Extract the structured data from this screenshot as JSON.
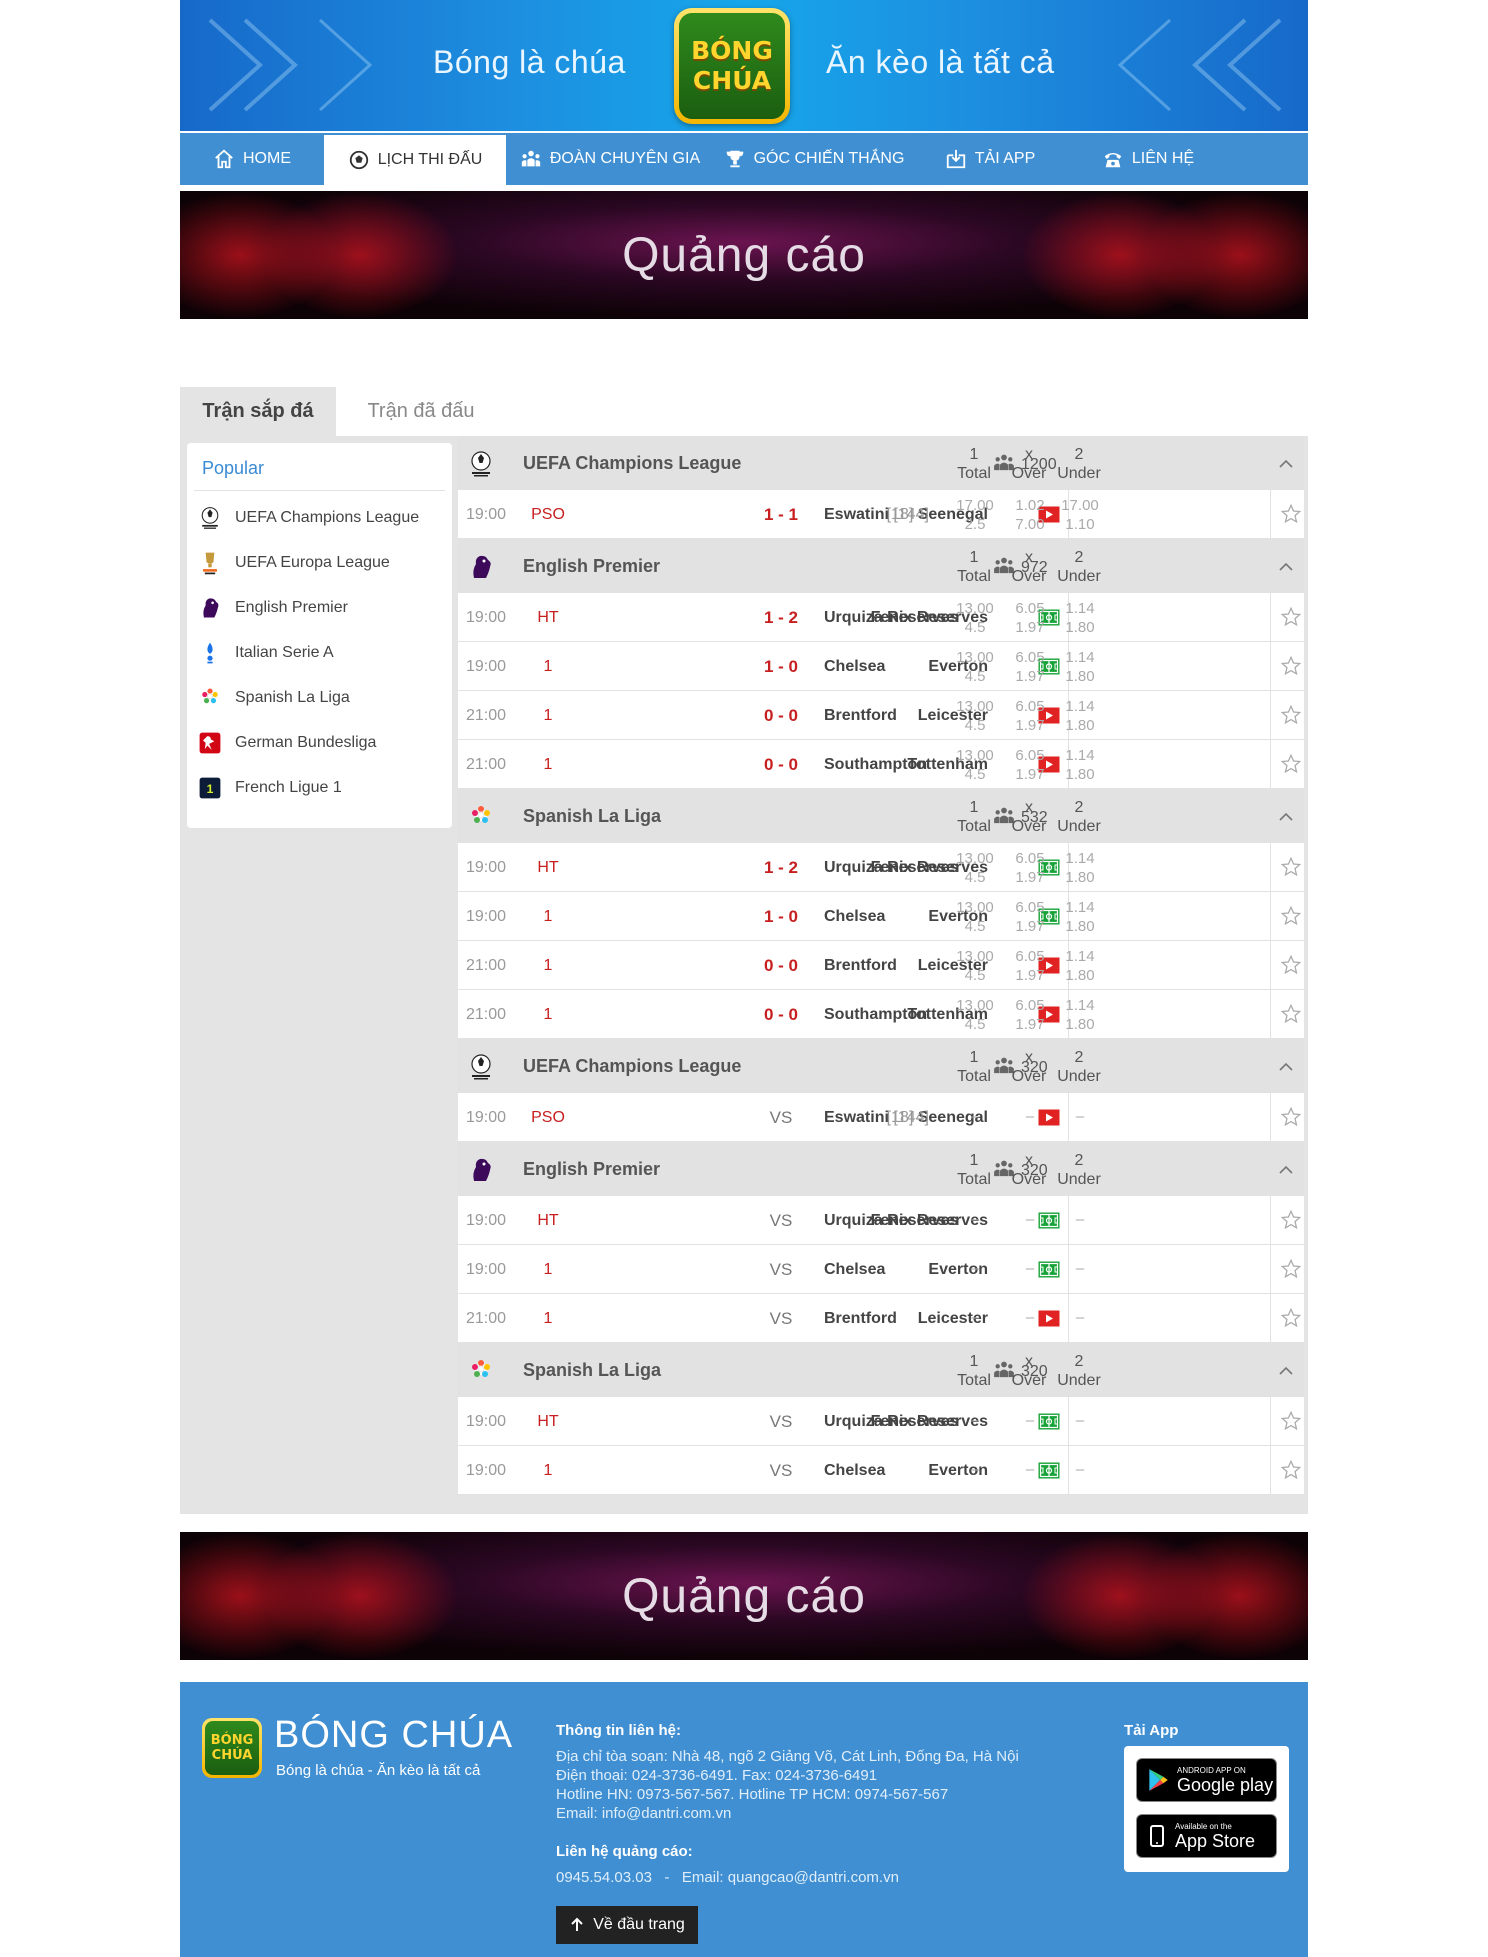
{
  "header": {
    "slogan_left": "Bóng là chúa",
    "slogan_right": "Ăn kèo là tất cả",
    "logo_line1": "BÓNG",
    "logo_line2": "CHÚA"
  },
  "nav": [
    {
      "label": "HOME",
      "icon": "home-icon",
      "active": false
    },
    {
      "label": "LỊCH THI ĐẤU",
      "icon": "soccer-ball-icon",
      "active": true
    },
    {
      "label": "ĐOÀN CHUYÊN GIA",
      "icon": "group-icon",
      "active": false
    },
    {
      "label": "GÓC CHIẾN THẮNG",
      "icon": "trophy-icon",
      "active": false
    },
    {
      "label": "TẢI APP",
      "icon": "download-icon",
      "active": false
    },
    {
      "label": "LIÊN HỆ",
      "icon": "phone-icon",
      "active": false
    }
  ],
  "ads": {
    "top": "Quảng cáo",
    "bottom": "Quảng cáo"
  },
  "tabs": {
    "upcoming": "Trận sắp đá",
    "played": "Trận đã đấu"
  },
  "sidebar": {
    "title": "Popular",
    "items": [
      {
        "label": "UEFA Champions League",
        "icon": "champions-league-icon"
      },
      {
        "label": "UEFA Europa League",
        "icon": "europa-league-icon"
      },
      {
        "label": "English Premier",
        "icon": "premier-league-icon"
      },
      {
        "label": "Italian Serie A",
        "icon": "serie-a-icon"
      },
      {
        "label": "Spanish La Liga",
        "icon": "la-liga-icon"
      },
      {
        "label": "German Bundesliga",
        "icon": "bundesliga-icon"
      },
      {
        "label": "French Ligue 1",
        "icon": "ligue-1-icon"
      }
    ]
  },
  "odds_columns": [
    {
      "top": "1",
      "bottom": "Total"
    },
    {
      "top": "x",
      "bottom": "Over"
    },
    {
      "top": "2",
      "bottom": "Under"
    }
  ],
  "leagues": [
    {
      "name": "UEFA Champions League",
      "icon": "champions-league-icon",
      "viewers": "1200",
      "matches": [
        {
          "time": "19:00",
          "status": "PSO",
          "home_rank": "[18]",
          "home": "Seenegal",
          "score": "1 - 1",
          "away": "Eswatini",
          "away_rank": "[144]",
          "media": "video",
          "odds": [
            [
              "17.00",
              "2.5"
            ],
            [
              "1.02",
              "7.00"
            ],
            [
              "17.00",
              "1.10"
            ]
          ]
        }
      ]
    },
    {
      "name": "English Premier",
      "icon": "premier-league-icon",
      "viewers": "972",
      "matches": [
        {
          "time": "19:00",
          "status": "HT",
          "home": "Fenix Reserves",
          "score": "1 - 2",
          "away": "Urquiza Reserves",
          "media": "pitch",
          "odds": [
            [
              "13.00",
              "4.5"
            ],
            [
              "6.05",
              "1.97"
            ],
            [
              "1.14",
              "1.80"
            ]
          ]
        },
        {
          "time": "19:00",
          "status": "1",
          "home": "Everton",
          "score": "1 - 0",
          "away": "Chelsea",
          "media": "pitch",
          "odds": [
            [
              "13.00",
              "4.5"
            ],
            [
              "6.05",
              "1.97"
            ],
            [
              "1.14",
              "1.80"
            ]
          ]
        },
        {
          "time": "21:00",
          "status": "1",
          "home": "Leicester",
          "score": "0 - 0",
          "away": "Brentford",
          "media": "video",
          "odds": [
            [
              "13.00",
              "4.5"
            ],
            [
              "6.05",
              "1.97"
            ],
            [
              "1.14",
              "1.80"
            ]
          ]
        },
        {
          "time": "21:00",
          "status": "1",
          "home": "Tottenham",
          "score": "0 - 0",
          "away": "Southampton",
          "media": "video",
          "odds": [
            [
              "13.00",
              "4.5"
            ],
            [
              "6.05",
              "1.97"
            ],
            [
              "1.14",
              "1.80"
            ]
          ]
        }
      ]
    },
    {
      "name": "Spanish La Liga",
      "icon": "la-liga-icon",
      "viewers": "532",
      "matches": [
        {
          "time": "19:00",
          "status": "HT",
          "home": "Fenix Reserves",
          "score": "1 - 2",
          "away": "Urquiza Reserves",
          "media": "pitch",
          "odds": [
            [
              "13.00",
              "4.5"
            ],
            [
              "6.05",
              "1.97"
            ],
            [
              "1.14",
              "1.80"
            ]
          ]
        },
        {
          "time": "19:00",
          "status": "1",
          "home": "Everton",
          "score": "1 - 0",
          "away": "Chelsea",
          "media": "pitch",
          "odds": [
            [
              "13.00",
              "4.5"
            ],
            [
              "6.05",
              "1.97"
            ],
            [
              "1.14",
              "1.80"
            ]
          ]
        },
        {
          "time": "21:00",
          "status": "1",
          "home": "Leicester",
          "score": "0 - 0",
          "away": "Brentford",
          "media": "video",
          "odds": [
            [
              "13.00",
              "4.5"
            ],
            [
              "6.05",
              "1.97"
            ],
            [
              "1.14",
              "1.80"
            ]
          ]
        },
        {
          "time": "21:00",
          "status": "1",
          "home": "Tottenham",
          "score": "0 - 0",
          "away": "Southampton",
          "media": "video",
          "odds": [
            [
              "13.00",
              "4.5"
            ],
            [
              "6.05",
              "1.97"
            ],
            [
              "1.14",
              "1.80"
            ]
          ]
        }
      ]
    },
    {
      "name": "UEFA Champions League",
      "icon": "champions-league-icon",
      "viewers": "320",
      "matches": [
        {
          "time": "19:00",
          "status": "PSO",
          "home_rank": "[18]",
          "home": "Seenegal",
          "score": "VS",
          "away": "Eswatini",
          "away_rank": "[144]",
          "media": "video",
          "odds": null
        }
      ]
    },
    {
      "name": "English Premier",
      "icon": "premier-league-icon",
      "viewers": "320",
      "matches": [
        {
          "time": "19:00",
          "status": "HT",
          "home": "Fenix Reserves",
          "score": "VS",
          "away": "Urquiza Reserves",
          "media": "pitch",
          "odds": null
        },
        {
          "time": "19:00",
          "status": "1",
          "home": "Everton",
          "score": "VS",
          "away": "Chelsea",
          "media": "pitch",
          "odds": null
        },
        {
          "time": "21:00",
          "status": "1",
          "home": "Leicester",
          "score": "VS",
          "away": "Brentford",
          "media": "video",
          "odds": null
        }
      ]
    },
    {
      "name": "Spanish La Liga",
      "icon": "la-liga-icon",
      "viewers": "320",
      "matches": [
        {
          "time": "19:00",
          "status": "HT",
          "home": "Fenix Reserves",
          "score": "VS",
          "away": "Urquiza Reserves",
          "media": "pitch",
          "odds": null
        },
        {
          "time": "19:00",
          "status": "1",
          "home": "Everton",
          "score": "VS",
          "away": "Chelsea",
          "media": "pitch",
          "odds": null
        }
      ]
    }
  ],
  "empty_odd": "–",
  "footer": {
    "logo_line1": "BÓNG",
    "logo_line2": "CHÚA",
    "brand": "BÓNG CHÚA",
    "slogan": "Bóng là chúa - Ăn kèo là tất cả",
    "contact_title": "Thông tin liên hệ:",
    "address": "Địa chỉ tòa soạn: Nhà 48, ngõ 2 Giảng Võ, Cát Linh, Đống Đa, Hà Nội",
    "phone": "Điện thoại: 024-3736-6491. Fax: 024-3736-6491",
    "hotline": "Hotline HN: 0973-567-567. Hotline TP HCM: 0974-567-567",
    "email": "Email: info@dantri.com.vn",
    "ads_title": "Liên hệ quảng cáo:",
    "ads_contact": "0945.54.03.03   -   Email: quangcao@dantri.com.vn",
    "back_to_top": "Về đầu trang",
    "app_title": "Tải App",
    "google_small": "ANDROID APP ON",
    "google_big": "Google play",
    "apple_small": "Available on the",
    "apple_big": "App Store"
  },
  "colors": {
    "nav": "#3f8fd2",
    "live_red": "#c71f1f",
    "panel_gray": "#e4e4e4",
    "popular_blue": "#3a8ad6"
  }
}
